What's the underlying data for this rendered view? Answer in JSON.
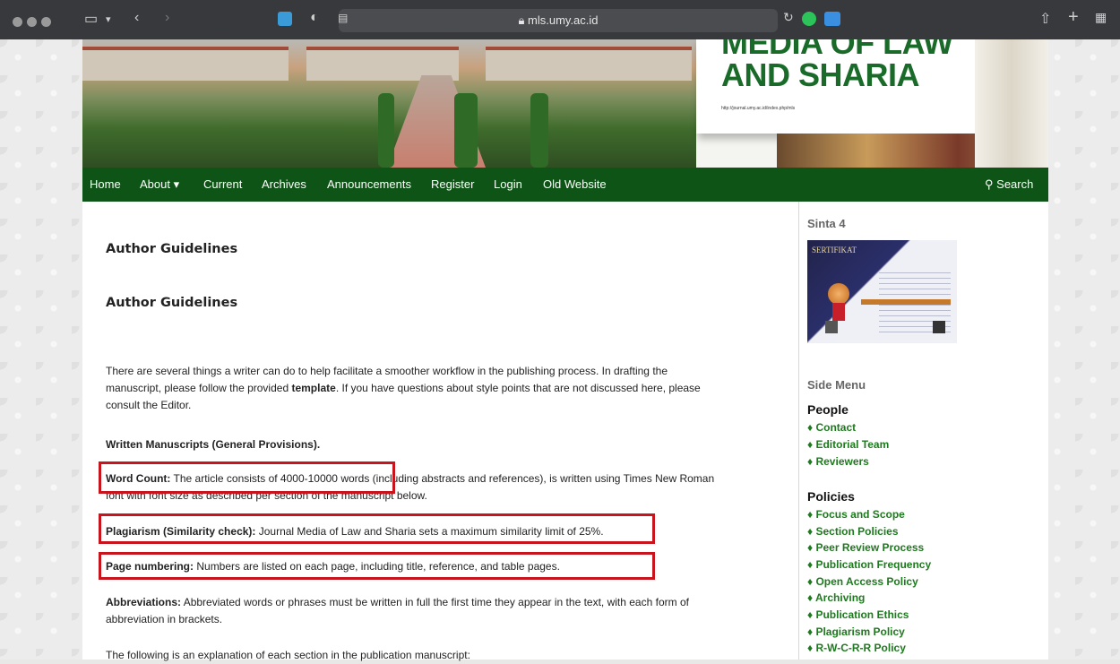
{
  "browser": {
    "url": "mls.umy.ac.id"
  },
  "nav": {
    "home": "Home",
    "about": "About ▾",
    "current": "Current",
    "archives": "Archives",
    "announcements": "Announcements",
    "register": "Register",
    "login": "Login",
    "old_website": "Old Website",
    "search": "Search"
  },
  "banner": {
    "title_line1": "MEDIA OF LAW",
    "title_line2": "AND SHARIA",
    "url": "http://journal.umy.ac.id/index.php/mls"
  },
  "main": {
    "heading1": "Author Guidelines",
    "heading2": "Author Guidelines",
    "intro_a": "There are several things a writer can do to help facilitate a smoother workflow in the publishing process. In drafting the",
    "intro_b_pre": "manuscript, please follow the provided ",
    "intro_b_bold": "template",
    "intro_b_post": ". If you have questions about style points that are not discussed here, please",
    "intro_c": "consult the Editor.",
    "written_heading": "Written Manuscripts (General Provisions).",
    "word_count_label": "Word Count:",
    "word_count_text_a": " The article consists of 4000-10000 words (including abstracts and references), is written using Times New Roman",
    "word_count_text_b": "font with font size as described per section of the manuscript below.",
    "plagiarism_label": "Plagiarism (Similarity check):",
    "plagiarism_text": " Journal Media of Law and Sharia sets a maximum similarity limit of 25%.",
    "page_numbering_label": "Page numbering:",
    "page_numbering_text": " Numbers are listed on each page, including title, reference, and table pages.",
    "abbrev_label": "Abbreviations:",
    "abbrev_text_a": " Abbreviated words or phrases must be written in full the first time they appear in the text, with each form of",
    "abbrev_text_b": "abbreviation in brackets.",
    "following": "The following is an explanation of each section in the publication manuscript:"
  },
  "sidebar": {
    "sinta": "Sinta 4",
    "cert_title": "SERTIFIKAT",
    "side_menu": "Side Menu",
    "people_heading": "People",
    "people": [
      "Contact",
      "Editorial Team",
      "Reviewers"
    ],
    "policies_heading": "Policies",
    "policies": [
      "Focus and Scope",
      "Section Policies",
      "Peer Review Process",
      "Publication Frequency",
      "Open Access Policy",
      "Archiving",
      "Publication Ethics",
      "Plagiarism Policy",
      "R-W-C-R-R Policy"
    ],
    "bullet": "♦"
  },
  "colors": {
    "nav_bg": "#0e5416",
    "link": "#1e7a1e",
    "highlight_box": "#c8141c"
  }
}
